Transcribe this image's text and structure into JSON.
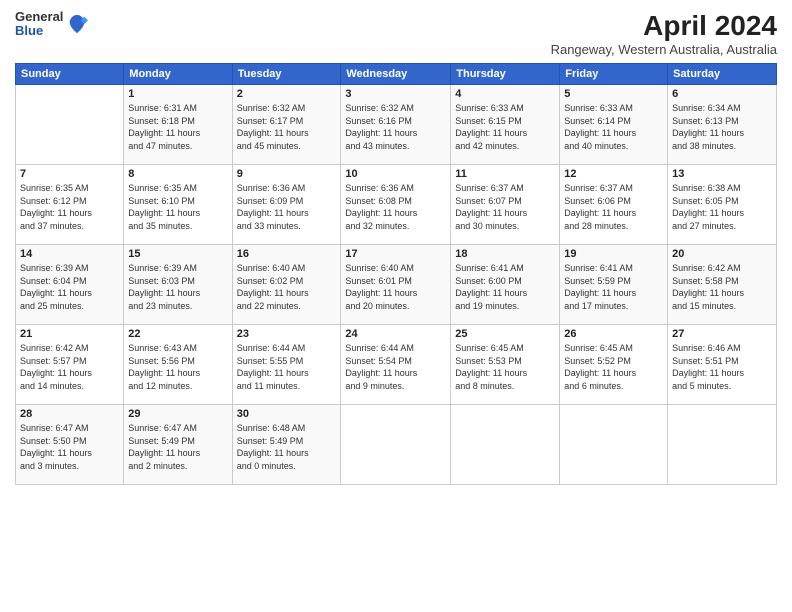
{
  "header": {
    "logo": {
      "line1": "General",
      "line2": "Blue"
    },
    "title": "April 2024",
    "subtitle": "Rangeway, Western Australia, Australia"
  },
  "calendar": {
    "days_of_week": [
      "Sunday",
      "Monday",
      "Tuesday",
      "Wednesday",
      "Thursday",
      "Friday",
      "Saturday"
    ],
    "weeks": [
      [
        {
          "day": "",
          "info": ""
        },
        {
          "day": "1",
          "info": "Sunrise: 6:31 AM\nSunset: 6:18 PM\nDaylight: 11 hours\nand 47 minutes."
        },
        {
          "day": "2",
          "info": "Sunrise: 6:32 AM\nSunset: 6:17 PM\nDaylight: 11 hours\nand 45 minutes."
        },
        {
          "day": "3",
          "info": "Sunrise: 6:32 AM\nSunset: 6:16 PM\nDaylight: 11 hours\nand 43 minutes."
        },
        {
          "day": "4",
          "info": "Sunrise: 6:33 AM\nSunset: 6:15 PM\nDaylight: 11 hours\nand 42 minutes."
        },
        {
          "day": "5",
          "info": "Sunrise: 6:33 AM\nSunset: 6:14 PM\nDaylight: 11 hours\nand 40 minutes."
        },
        {
          "day": "6",
          "info": "Sunrise: 6:34 AM\nSunset: 6:13 PM\nDaylight: 11 hours\nand 38 minutes."
        }
      ],
      [
        {
          "day": "7",
          "info": "Sunrise: 6:35 AM\nSunset: 6:12 PM\nDaylight: 11 hours\nand 37 minutes."
        },
        {
          "day": "8",
          "info": "Sunrise: 6:35 AM\nSunset: 6:10 PM\nDaylight: 11 hours\nand 35 minutes."
        },
        {
          "day": "9",
          "info": "Sunrise: 6:36 AM\nSunset: 6:09 PM\nDaylight: 11 hours\nand 33 minutes."
        },
        {
          "day": "10",
          "info": "Sunrise: 6:36 AM\nSunset: 6:08 PM\nDaylight: 11 hours\nand 32 minutes."
        },
        {
          "day": "11",
          "info": "Sunrise: 6:37 AM\nSunset: 6:07 PM\nDaylight: 11 hours\nand 30 minutes."
        },
        {
          "day": "12",
          "info": "Sunrise: 6:37 AM\nSunset: 6:06 PM\nDaylight: 11 hours\nand 28 minutes."
        },
        {
          "day": "13",
          "info": "Sunrise: 6:38 AM\nSunset: 6:05 PM\nDaylight: 11 hours\nand 27 minutes."
        }
      ],
      [
        {
          "day": "14",
          "info": "Sunrise: 6:39 AM\nSunset: 6:04 PM\nDaylight: 11 hours\nand 25 minutes."
        },
        {
          "day": "15",
          "info": "Sunrise: 6:39 AM\nSunset: 6:03 PM\nDaylight: 11 hours\nand 23 minutes."
        },
        {
          "day": "16",
          "info": "Sunrise: 6:40 AM\nSunset: 6:02 PM\nDaylight: 11 hours\nand 22 minutes."
        },
        {
          "day": "17",
          "info": "Sunrise: 6:40 AM\nSunset: 6:01 PM\nDaylight: 11 hours\nand 20 minutes."
        },
        {
          "day": "18",
          "info": "Sunrise: 6:41 AM\nSunset: 6:00 PM\nDaylight: 11 hours\nand 19 minutes."
        },
        {
          "day": "19",
          "info": "Sunrise: 6:41 AM\nSunset: 5:59 PM\nDaylight: 11 hours\nand 17 minutes."
        },
        {
          "day": "20",
          "info": "Sunrise: 6:42 AM\nSunset: 5:58 PM\nDaylight: 11 hours\nand 15 minutes."
        }
      ],
      [
        {
          "day": "21",
          "info": "Sunrise: 6:42 AM\nSunset: 5:57 PM\nDaylight: 11 hours\nand 14 minutes."
        },
        {
          "day": "22",
          "info": "Sunrise: 6:43 AM\nSunset: 5:56 PM\nDaylight: 11 hours\nand 12 minutes."
        },
        {
          "day": "23",
          "info": "Sunrise: 6:44 AM\nSunset: 5:55 PM\nDaylight: 11 hours\nand 11 minutes."
        },
        {
          "day": "24",
          "info": "Sunrise: 6:44 AM\nSunset: 5:54 PM\nDaylight: 11 hours\nand 9 minutes."
        },
        {
          "day": "25",
          "info": "Sunrise: 6:45 AM\nSunset: 5:53 PM\nDaylight: 11 hours\nand 8 minutes."
        },
        {
          "day": "26",
          "info": "Sunrise: 6:45 AM\nSunset: 5:52 PM\nDaylight: 11 hours\nand 6 minutes."
        },
        {
          "day": "27",
          "info": "Sunrise: 6:46 AM\nSunset: 5:51 PM\nDaylight: 11 hours\nand 5 minutes."
        }
      ],
      [
        {
          "day": "28",
          "info": "Sunrise: 6:47 AM\nSunset: 5:50 PM\nDaylight: 11 hours\nand 3 minutes."
        },
        {
          "day": "29",
          "info": "Sunrise: 6:47 AM\nSunset: 5:49 PM\nDaylight: 11 hours\nand 2 minutes."
        },
        {
          "day": "30",
          "info": "Sunrise: 6:48 AM\nSunset: 5:49 PM\nDaylight: 11 hours\nand 0 minutes."
        },
        {
          "day": "",
          "info": ""
        },
        {
          "day": "",
          "info": ""
        },
        {
          "day": "",
          "info": ""
        },
        {
          "day": "",
          "info": ""
        }
      ]
    ]
  }
}
